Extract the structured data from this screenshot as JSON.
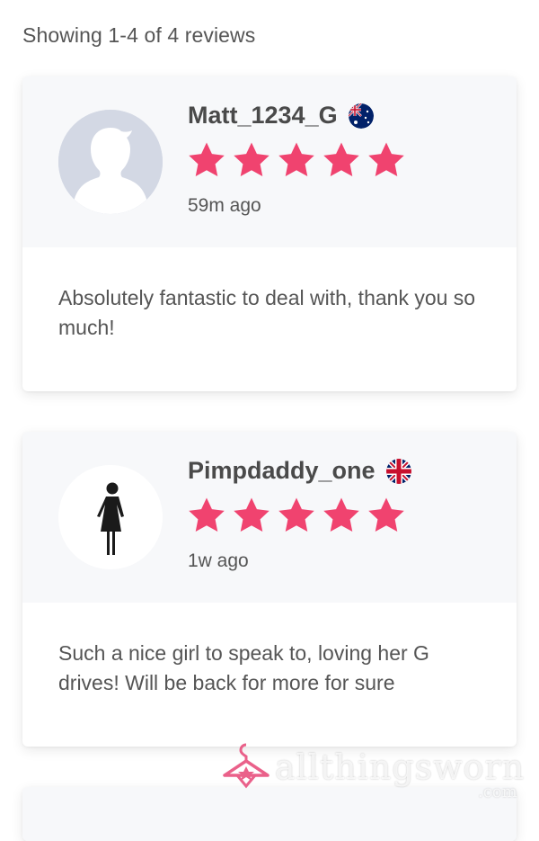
{
  "summary": "Showing 1-4 of 4 reviews",
  "reviews": [
    {
      "username": "Matt_1234_G",
      "flag": "flag-australia-icon",
      "avatar": "default-avatar",
      "rating": 5,
      "time": "59m ago",
      "text": "Absolutely fantastic to deal with, thank you so much!"
    },
    {
      "username": "Pimpdaddy_one",
      "flag": "flag-uk-icon",
      "avatar": "female-figure-avatar",
      "rating": 5,
      "time": "1w ago",
      "text": "Such a nice girl to speak to, loving her G drives! Will be back for more for sure"
    }
  ],
  "colors": {
    "star": "#f0436f",
    "card_header": "#f7f8fa",
    "watermark": "#e8507e"
  },
  "watermark": {
    "text": "allthingsworn",
    "suffix": ".com"
  }
}
